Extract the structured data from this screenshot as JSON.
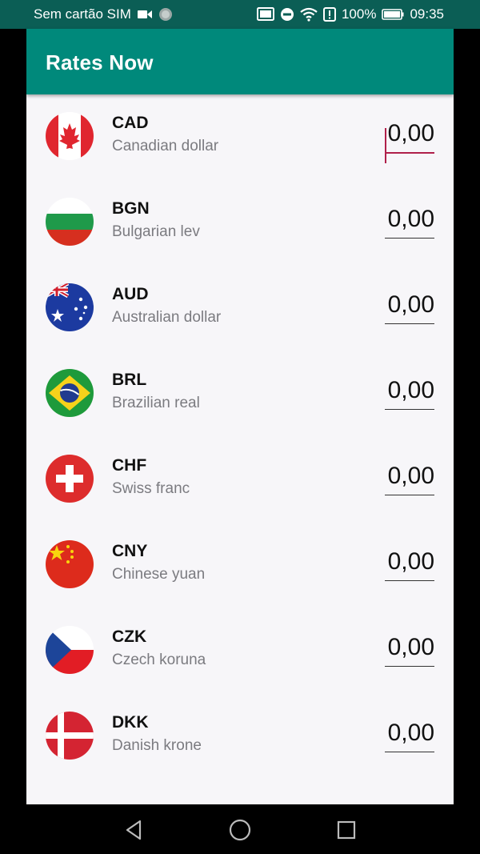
{
  "status": {
    "carrier": "Sem cartão SIM",
    "battery": "100%",
    "time": "09:35"
  },
  "app": {
    "title": "Rates Now"
  },
  "currencies": [
    {
      "code": "CAD",
      "name": "Canadian dollar",
      "amount": "0,00",
      "flag": "canada-flag-icon"
    },
    {
      "code": "BGN",
      "name": "Bulgarian lev",
      "amount": "0,00",
      "flag": "bulgaria-flag-icon"
    },
    {
      "code": "AUD",
      "name": "Australian dollar",
      "amount": "0,00",
      "flag": "australia-flag-icon"
    },
    {
      "code": "BRL",
      "name": "Brazilian real",
      "amount": "0,00",
      "flag": "brazil-flag-icon"
    },
    {
      "code": "CHF",
      "name": "Swiss franc",
      "amount": "0,00",
      "flag": "switzerland-flag-icon"
    },
    {
      "code": "CNY",
      "name": "Chinese yuan",
      "amount": "0,00",
      "flag": "china-flag-icon"
    },
    {
      "code": "CZK",
      "name": "Czech koruna",
      "amount": "0,00",
      "flag": "czech-flag-icon"
    },
    {
      "code": "DKK",
      "name": "Danish krone",
      "amount": "0,00",
      "flag": "denmark-flag-icon"
    }
  ],
  "colors": {
    "app_bar": "#00897b",
    "status_bar": "#0b5e55",
    "accent": "#b0204a",
    "background": "#f7f6f9"
  }
}
